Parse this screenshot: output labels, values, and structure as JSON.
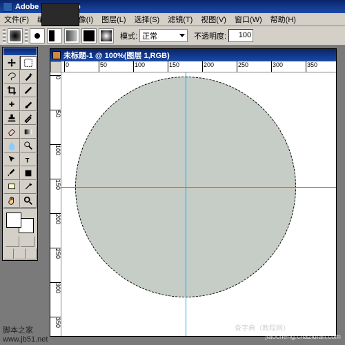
{
  "app": {
    "title": "Adobe Photoshop"
  },
  "menu": {
    "items": [
      "文件(F)",
      "编辑(E)",
      "图像(I)",
      "图层(L)",
      "选择(S)",
      "滤镜(T)",
      "视图(V)",
      "窗口(W)",
      "帮助(H)"
    ]
  },
  "options": {
    "mode_label": "模式:",
    "mode_value": "正常",
    "opacity_label": "不透明度:",
    "opacity_value": "100"
  },
  "document": {
    "title": "未标题-1 @ 100%(图层 1,RGB)",
    "ruler_h": [
      "0",
      "50",
      "100",
      "150",
      "200",
      "250",
      "300",
      "350"
    ],
    "ruler_v": [
      "0",
      "50",
      "100",
      "150",
      "200",
      "250",
      "300",
      "350"
    ]
  },
  "tools": [
    {
      "name": "move-tool",
      "icon": "move"
    },
    {
      "name": "marquee-tool",
      "icon": "marquee",
      "active": true
    },
    {
      "name": "lasso-tool",
      "icon": "lasso"
    },
    {
      "name": "wand-tool",
      "icon": "wand"
    },
    {
      "name": "crop-tool",
      "icon": "crop"
    },
    {
      "name": "slice-tool",
      "icon": "slice"
    },
    {
      "name": "heal-tool",
      "icon": "heal"
    },
    {
      "name": "brush-tool",
      "icon": "brush"
    },
    {
      "name": "stamp-tool",
      "icon": "stamp"
    },
    {
      "name": "history-brush-tool",
      "icon": "hbrush"
    },
    {
      "name": "eraser-tool",
      "icon": "eraser"
    },
    {
      "name": "gradient-tool",
      "icon": "gradient"
    },
    {
      "name": "blur-tool",
      "icon": "blur"
    },
    {
      "name": "dodge-tool",
      "icon": "dodge"
    },
    {
      "name": "path-select-tool",
      "icon": "psel"
    },
    {
      "name": "type-tool",
      "icon": "type"
    },
    {
      "name": "pen-tool",
      "icon": "pen"
    },
    {
      "name": "shape-tool",
      "icon": "shape"
    },
    {
      "name": "notes-tool",
      "icon": "notes"
    },
    {
      "name": "eyedrop-tool",
      "icon": "eyedrop"
    },
    {
      "name": "hand-tool",
      "icon": "hand"
    },
    {
      "name": "zoom-tool",
      "icon": "zoom"
    }
  ],
  "colors": {
    "fg": "#ffffff",
    "bg": "#ffffff",
    "circle": "#c6ccc6",
    "guide": "#00aaff"
  },
  "watermarks": {
    "site1": "www.jb51.net",
    "site2": "脚本之家",
    "site3": "jiaocheng.chazidian.com",
    "site4": "查字典（教程网）"
  }
}
